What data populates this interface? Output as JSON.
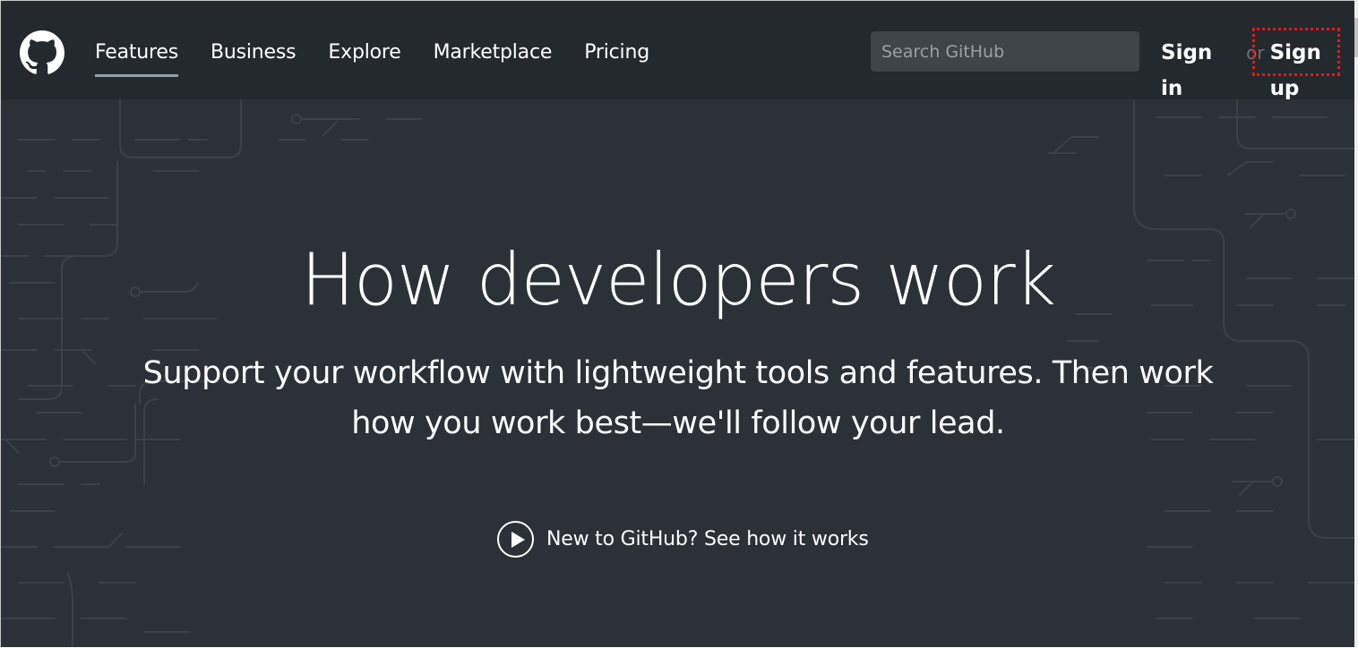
{
  "header": {
    "logo_icon": "github-octocat-icon",
    "nav": [
      {
        "label": "Features",
        "active": true
      },
      {
        "label": "Business",
        "active": false
      },
      {
        "label": "Explore",
        "active": false
      },
      {
        "label": "Marketplace",
        "active": false
      },
      {
        "label": "Pricing",
        "active": false
      }
    ],
    "search_placeholder": "Search GitHub",
    "sign_in": "Sign in",
    "or": "or",
    "sign_up": "Sign up"
  },
  "hero": {
    "title": "How developers work",
    "subtitle": "Support your workflow with lightweight tools and features. Then work how you work best—we'll follow your lead.",
    "cta_icon": "play-circle-icon",
    "cta_label": "New to GitHub? See how it works"
  },
  "colors": {
    "header_bg": "#24292e",
    "hero_bg": "#2b3137",
    "highlight": "#e01b1b"
  }
}
